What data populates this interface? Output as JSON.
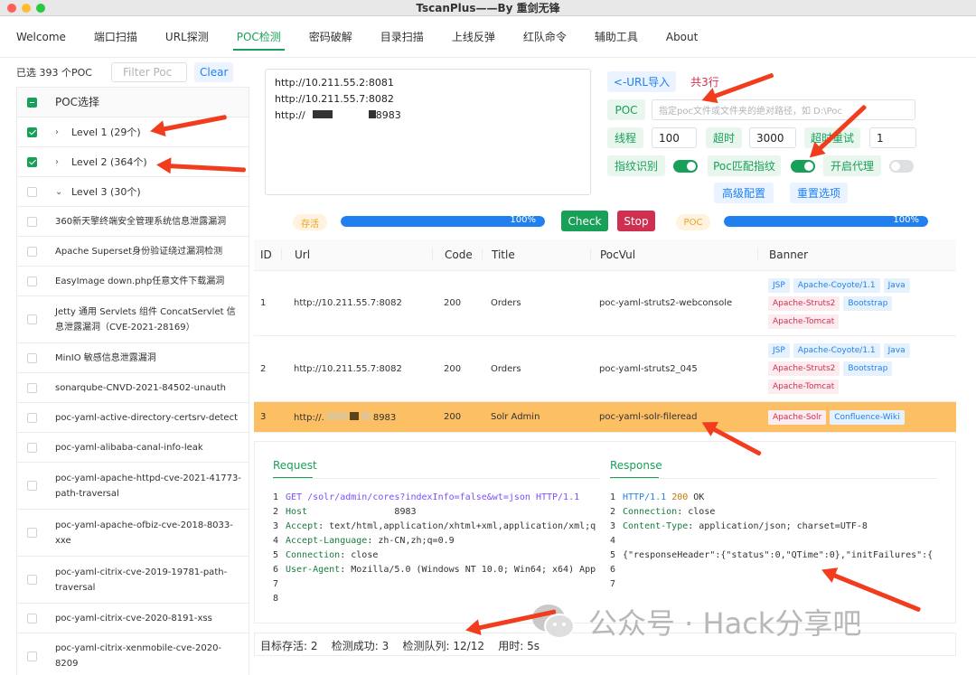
{
  "window": {
    "title": "TscanPlus——By 重剑无锋"
  },
  "menu": [
    {
      "label": "Welcome",
      "active": false
    },
    {
      "label": "端口扫描",
      "active": false
    },
    {
      "label": "URL探测",
      "active": false
    },
    {
      "label": "POC检测",
      "active": true
    },
    {
      "label": "密码破解",
      "active": false
    },
    {
      "label": "目录扫描",
      "active": false
    },
    {
      "label": "上线反弹",
      "active": false
    },
    {
      "label": "红队命令",
      "active": false
    },
    {
      "label": "辅助工具",
      "active": false
    },
    {
      "label": "About",
      "active": false
    }
  ],
  "left": {
    "selected_count": "已选 393 个POC",
    "filter_placeholder": "Filter Poc",
    "clear_label": "Clear",
    "header": "POC选择",
    "levels": [
      {
        "label": "Level 1 (29个)",
        "checked": true
      },
      {
        "label": "Level 2 (364个)",
        "checked": true
      },
      {
        "label": "Level 3 (30个)",
        "checked": false
      }
    ],
    "items": [
      "360新天擎终端安全管理系统信息泄露漏洞",
      "Apache Superset身份验证绕过漏洞检测",
      "EasyImage down.php任意文件下载漏洞",
      "Jetty 通用 Servlets 组件 ConcatServlet 信息泄露漏洞（CVE-2021-28169）",
      "MinIO 敏感信息泄露漏洞",
      "sonarqube-CNVD-2021-84502-unauth",
      "poc-yaml-active-directory-certsrv-detect",
      "poc-yaml-alibaba-canal-info-leak",
      "poc-yaml-apache-httpd-cve-2021-41773-path-traversal",
      "poc-yaml-apache-ofbiz-cve-2018-8033-xxe",
      "poc-yaml-citrix-cve-2019-19781-path-traversal",
      "poc-yaml-citrix-cve-2020-8191-xss",
      "poc-yaml-citrix-xenmobile-cve-2020-8209"
    ]
  },
  "targets": {
    "lines": [
      "http://10.211.55.2:8081",
      "http://10.211.55.7:8082",
      "http://",
      "8983"
    ]
  },
  "config": {
    "url_import": "<-URL导入",
    "line_count": "共3行",
    "poc_label": "POC",
    "poc_placeholder": "指定poc文件或文件夹的绝对路径，如 D:\\Poc",
    "threads_label": "线程",
    "threads_value": "100",
    "timeout_label": "超时",
    "timeout_value": "3000",
    "retry_label": "超时重试",
    "retry_value": "1",
    "fingerprint_label": "指纹识别",
    "fingerprint_on": true,
    "poc_match_label": "Poc匹配指纹",
    "poc_match_on": true,
    "proxy_label": "开启代理",
    "proxy_on": false,
    "advanced": "高级配置",
    "reset": "重置选项"
  },
  "progress": {
    "alive_label": "存活",
    "alive_value": "100%",
    "alive_fraction": 1.0,
    "check": "Check",
    "stop": "Stop",
    "poc_label": "POC",
    "poc_value": "100%",
    "poc_fraction": 1.0
  },
  "table": {
    "headers": [
      "ID",
      "Url",
      "Code",
      "Title",
      "PocVul",
      "Banner"
    ],
    "rows": [
      {
        "id": "1",
        "url": "http://10.211.55.7:8082",
        "code": "200",
        "title": "Orders",
        "vul": "poc-yaml-struts2-webconsole",
        "tags": [
          {
            "t": "JSP",
            "c": "blue"
          },
          {
            "t": "Apache-Coyote/1.1",
            "c": "blue"
          },
          {
            "t": "Java",
            "c": "blue"
          },
          {
            "t": "Apache-Struts2",
            "c": "red"
          },
          {
            "t": "Bootstrap",
            "c": "blue"
          },
          {
            "t": "Apache-Tomcat",
            "c": "red"
          }
        ]
      },
      {
        "id": "2",
        "url": "http://10.211.55.7:8082",
        "code": "200",
        "title": "Orders",
        "vul": "poc-yaml-struts2_045",
        "tags": [
          {
            "t": "JSP",
            "c": "blue"
          },
          {
            "t": "Apache-Coyote/1.1",
            "c": "blue"
          },
          {
            "t": "Java",
            "c": "blue"
          },
          {
            "t": "Apache-Struts2",
            "c": "red"
          },
          {
            "t": "Bootstrap",
            "c": "blue"
          },
          {
            "t": "Apache-Tomcat",
            "c": "red"
          }
        ]
      },
      {
        "id": "3",
        "url": "http://.",
        "url_tail": "8983",
        "code": "200",
        "title": "Solr Admin",
        "vul": "poc-yaml-solr-fileread",
        "tags": [
          {
            "t": "Apache-Solr",
            "c": "red"
          },
          {
            "t": "Confluence-Wiki",
            "c": "blue"
          }
        ]
      }
    ]
  },
  "request": {
    "title": "Request",
    "lines": [
      {
        "n": "1",
        "parts": [
          [
            "kw",
            "GET /solr/admin/cores?indexInfo=false&wt=json HTTP/1.1"
          ]
        ]
      },
      {
        "n": "2",
        "parts": [
          [
            "ky",
            "Host"
          ],
          [
            "",
            "                8983"
          ]
        ]
      },
      {
        "n": "3",
        "parts": [
          [
            "ky",
            "Accept"
          ],
          [
            "",
            ": text/html,application/xhtml+xml,application/xml;q"
          ]
        ]
      },
      {
        "n": "4",
        "parts": [
          [
            "ky",
            "Accept-Language"
          ],
          [
            "",
            ": zh-CN,zh;q=0.9"
          ]
        ]
      },
      {
        "n": "5",
        "parts": [
          [
            "ky",
            "Connection"
          ],
          [
            "",
            ": close"
          ]
        ]
      },
      {
        "n": "6",
        "parts": [
          [
            "ky",
            "User-Agent"
          ],
          [
            "",
            ": Mozilla/5.0 (Windows NT 10.0; Win64; x64) App"
          ]
        ]
      },
      {
        "n": "7",
        "parts": []
      },
      {
        "n": "8",
        "parts": []
      }
    ]
  },
  "response": {
    "title": "Response",
    "lines": [
      {
        "n": "1",
        "parts": [
          [
            "hv",
            "HTTP/1.1 "
          ],
          [
            "num",
            "200"
          ],
          [
            "",
            " OK"
          ]
        ]
      },
      {
        "n": "2",
        "parts": [
          [
            "ky",
            "Connection"
          ],
          [
            "",
            ": close"
          ]
        ]
      },
      {
        "n": "3",
        "parts": [
          [
            "ky",
            "Content-Type"
          ],
          [
            "",
            ": application/json; charset=UTF-8"
          ]
        ]
      },
      {
        "n": "4",
        "parts": []
      },
      {
        "n": "5",
        "parts": [
          [
            "",
            "{\"responseHeader\":{\"status\":0,\"QTime\":0},\"initFailures\":{"
          ]
        ]
      },
      {
        "n": "6",
        "parts": []
      },
      {
        "n": "7",
        "parts": []
      }
    ]
  },
  "status": {
    "alive": "目标存活: 2",
    "success": "检测成功: 3",
    "queue": "检测队列: 12/12",
    "time": "用时: 5s"
  },
  "watermark": "公众号 · Hack分享吧",
  "colors": {
    "accent": "#18a058",
    "link": "#2080f0",
    "danger": "#d03050",
    "selected_row": "#fcbf63",
    "arrow": "#f23c1e"
  }
}
